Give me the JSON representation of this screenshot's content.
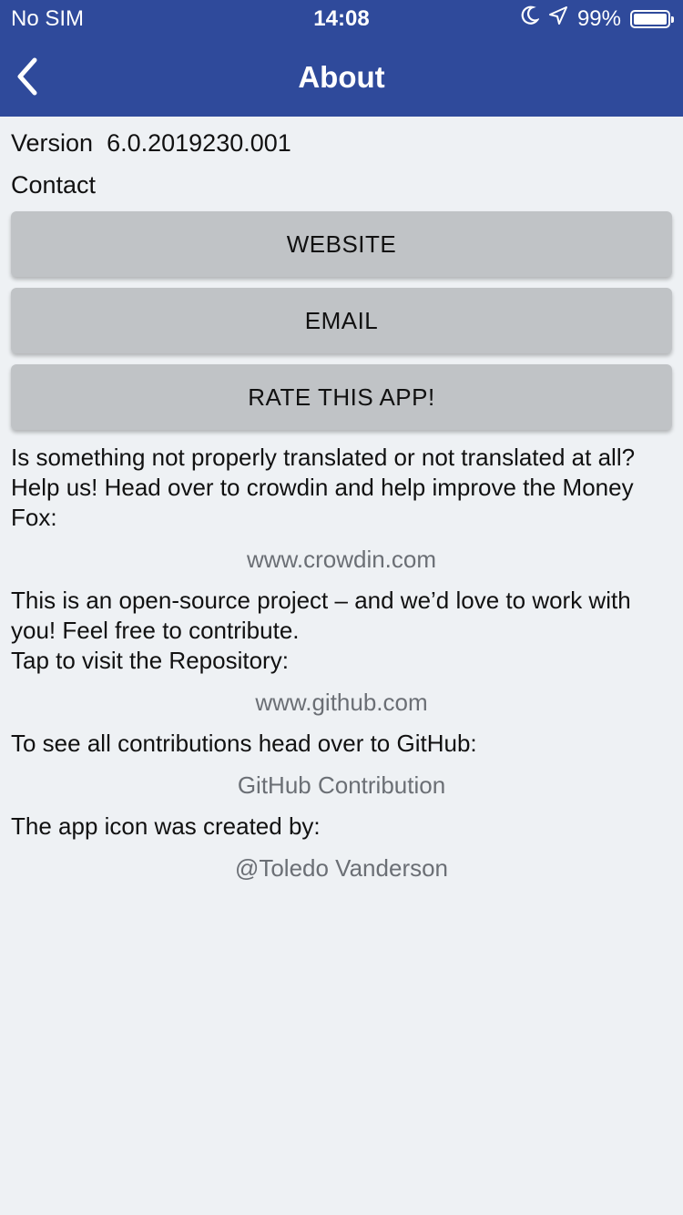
{
  "status_bar": {
    "carrier": "No SIM",
    "time": "14:08",
    "battery_percent": "99%",
    "battery_level": 0.99,
    "icons": [
      "moon-icon",
      "location-arrow-icon",
      "battery-icon"
    ]
  },
  "nav": {
    "title": "About",
    "back_icon": "chevron-left-icon",
    "bar_color": "#2f4a9b"
  },
  "about": {
    "version_label": "Version",
    "version_value": "6.0.2019230.001",
    "contact_label": "Contact",
    "buttons": {
      "website": "WEBSITE",
      "email": "EMAIL",
      "rate": "RATE THIS APP!"
    },
    "translate_text": "Is something not properly translated or not translated at all? Help us! Head over to crowdin and help improve the Money Fox:",
    "crowdin_link": "www.crowdin.com",
    "opensource_line1": "This is an open-source project – and we’d love to work with you! Feel free to contribute.",
    "opensource_line2": "Tap to visit the Repository:",
    "github_link": "www.github.com",
    "contributions_text": "To see all contributions head over to GitHub:",
    "contributions_link": "GitHub Contribution",
    "icon_credit_text": "The app icon was created by:",
    "icon_credit_link": "@Toledo Vanderson"
  }
}
